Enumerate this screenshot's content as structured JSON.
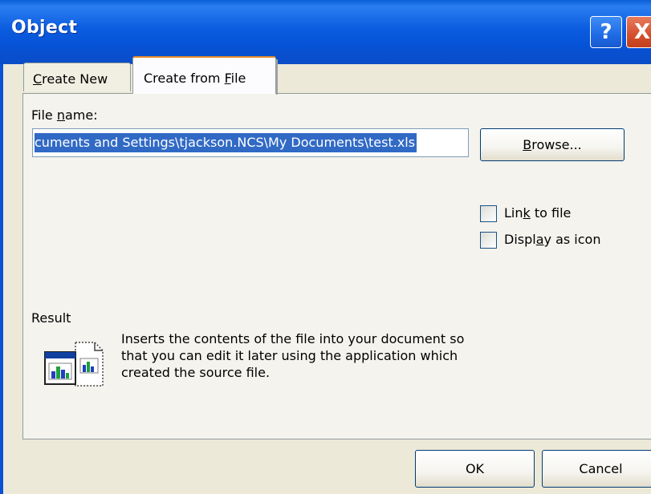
{
  "window": {
    "title": "Object",
    "help_glyph": "?",
    "close_glyph": "X"
  },
  "tabs": [
    {
      "prefix": "",
      "accel": "C",
      "suffix": "reate New"
    },
    {
      "prefix": "Create from ",
      "accel": "F",
      "suffix": "ile"
    }
  ],
  "file_name": {
    "label_prefix": "File ",
    "label_accel": "n",
    "label_suffix": "ame:",
    "value": "cuments and Settings\\tjackson.NCS\\My Documents\\test.xls"
  },
  "browse": {
    "accel": "B",
    "suffix": "rowse..."
  },
  "options": {
    "link": {
      "prefix": "Lin",
      "accel": "k",
      "suffix": " to file"
    },
    "display_icon": {
      "prefix": "Displ",
      "accel": "a",
      "suffix": "y as icon"
    }
  },
  "result": {
    "label": "Result",
    "text": "Inserts the contents of the file into your document so that you can edit it later using the application which created the source file."
  },
  "buttons": {
    "ok": "OK",
    "cancel": "Cancel"
  },
  "colors": {
    "titlebar": "#0a5fd8",
    "selection": "#316ac5",
    "active_tab_accent": "#e68b2c",
    "dialog_bg": "#ece9d8"
  },
  "icons": {
    "help": "help-icon",
    "close": "close-icon",
    "result": "result-file-icon"
  }
}
